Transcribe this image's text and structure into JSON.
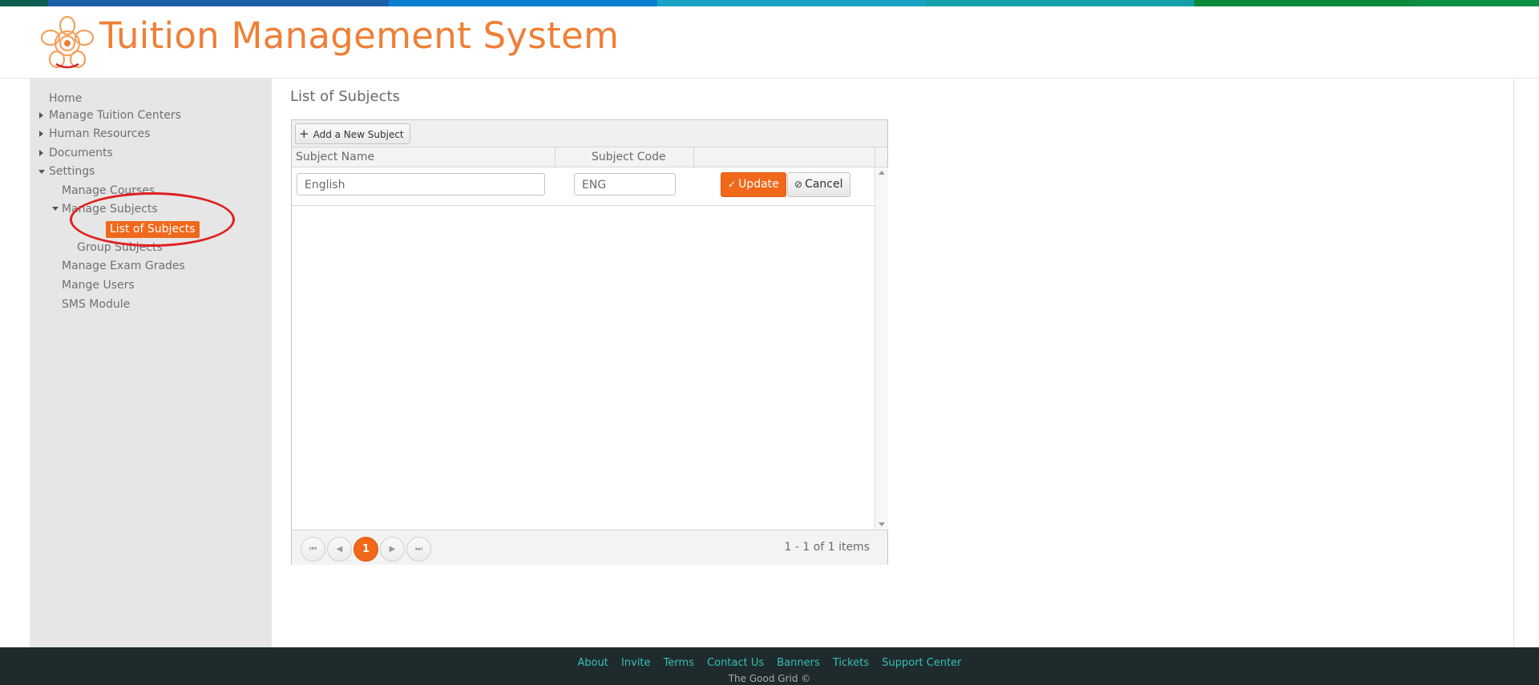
{
  "colors": {
    "accent": "#f0681a",
    "title": "#f07f35",
    "footer_bg": "#1f2a2c",
    "footer_link": "#36c0b8",
    "annotation": "#e02020"
  },
  "topbar_colors": [
    "#0d5d4f",
    "#1b5fa8",
    "#0b7fcf",
    "#1ba3c4",
    "#12a1a8",
    "#0b8a3a",
    "#0a8f45",
    "#0b6d4e",
    "#0a5f55",
    "#1a63c5"
  ],
  "header": {
    "title": "Tuition Management System",
    "logo_icon": "flower-logo-icon"
  },
  "sidebar": {
    "home": "Home",
    "tuition_centers": "Manage Tuition Centers",
    "human_resources": "Human Resources",
    "documents": "Documents",
    "settings": "Settings",
    "manage_courses": "Manage Courses",
    "manage_subjects": "Manage Subjects",
    "list_of_subjects": "List of Subjects",
    "group_subjects": "Group Subjects",
    "manage_exam_grades": "Manage Exam Grades",
    "mange_users": "Mange Users",
    "sms_module": "SMS Module"
  },
  "main": {
    "title": "List of Subjects",
    "toolbar": {
      "add_label": "Add a New Subject"
    },
    "columns": {
      "name": "Subject Name",
      "code": "Subject Code"
    },
    "edit_row": {
      "name": "English",
      "code": "ENG",
      "update": "Update",
      "cancel": "Cancel"
    },
    "pager": {
      "current": "1",
      "info": "1 - 1 of 1 items"
    }
  },
  "footer": {
    "links": {
      "about": "About",
      "invite": "Invite",
      "terms": "Terms",
      "contact": "Contact Us",
      "banners": "Banners",
      "tickets": "Tickets",
      "support": "Support Center"
    },
    "copyright": "The Good Grid ©"
  }
}
